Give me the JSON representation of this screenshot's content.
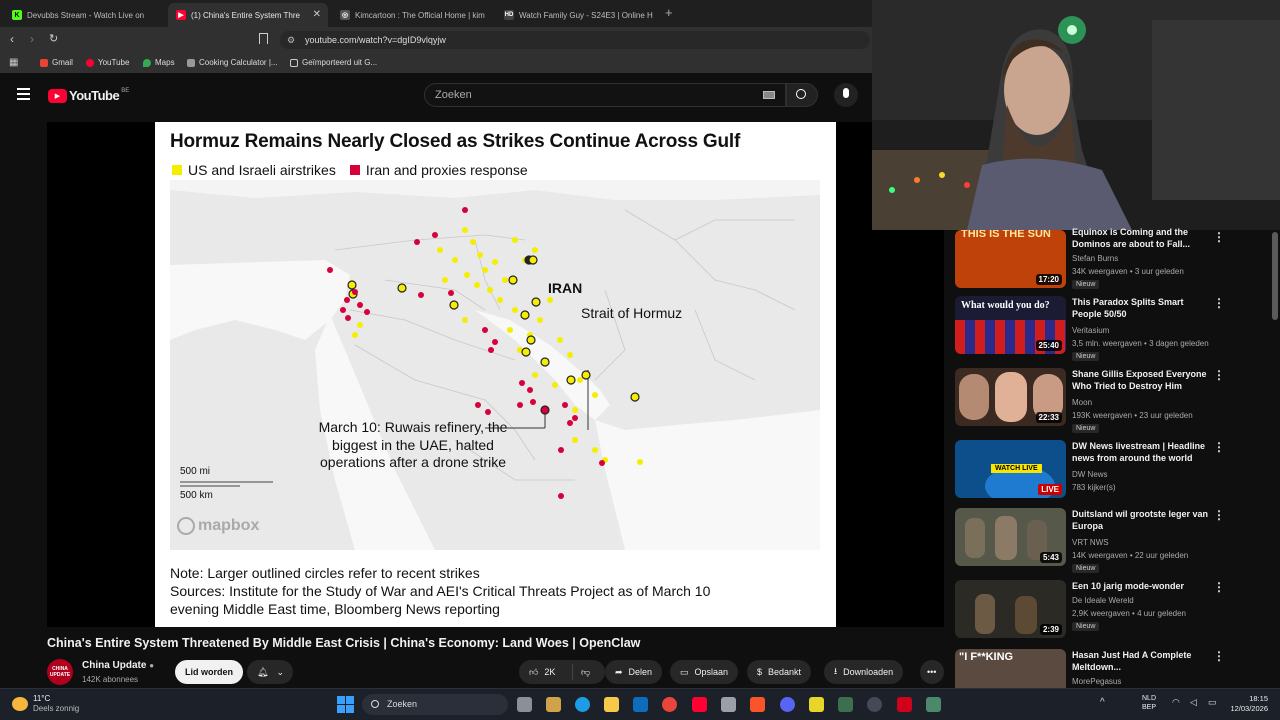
{
  "browser": {
    "tabs": [
      {
        "title": "Devubbs Stream - Watch Live on",
        "active": false
      },
      {
        "title": "(1) China's Entire System Thre",
        "active": true
      },
      {
        "title": "Kimcartoon : The Official Home | kim",
        "active": false
      },
      {
        "title": "Watch Family Guy - S24E3 | Online H",
        "active": false
      }
    ],
    "url": "youtube.com/watch?v=dgID9vlqyjw",
    "bookmarks": [
      "Gmail",
      "YouTube",
      "Maps",
      "Cooking Calculator |...",
      "Geïmporteerd uit G..."
    ]
  },
  "youtube": {
    "logo": "YouTube",
    "logo_region": "BE",
    "search_placeholder": "Zoeken"
  },
  "video_frame": {
    "title": "Hormuz Remains Nearly Closed as Strikes Continue Across Gulf",
    "legend": [
      {
        "label": "US and Israeli airstrikes",
        "color": "#f5ee00"
      },
      {
        "label": "Iran and proxies response",
        "color": "#d6003c"
      }
    ],
    "map_labels": {
      "country": "IRAN",
      "strait": "Strait of Hormuz",
      "annotation_line1": "March 10: Ruwais refinery, the",
      "annotation_line2": "biggest in the UAE, halted",
      "annotation_line3": "operations after a drone strike",
      "scale_mi": "500 mi",
      "scale_km": "500 km",
      "attribution": "mapbox"
    },
    "note": "Note: Larger outlined circles refer to recent strikes",
    "sources_line1": "Sources: Institute for the Study of War and AEI's Critical Threats Project as of March 10",
    "sources_line2": "evening Middle East time, Bloomberg News reporting"
  },
  "video": {
    "title": "China's Entire System Threatened By Middle East Crisis | China's Economy: Land Woes | OpenClaw",
    "channel": "China Update",
    "channel_avatar_text": "CHINA UPDATE",
    "subscribers": "142K abonnees",
    "subscribe_label": "Lid worden",
    "likes": "2K",
    "share_label": "Delen",
    "save_label": "Opslaan",
    "thanks_label": "Bedankt",
    "download_label": "Downloaden"
  },
  "recommendations": [
    {
      "title": "Equinox is Coming and the Dominos are about to Fall...",
      "channel": "Stefan Burns",
      "meta": "34K weergaven • 3 uur geleden",
      "badge": "Nieuw",
      "duration": "17:20",
      "thumb_text": "THIS IS THE SUN",
      "thumb_color": "#c0420b"
    },
    {
      "title": "This Paradox Splits Smart People 50/50",
      "channel": "Veritasium",
      "meta": "3,5 mln. weergaven • 3 dagen geleden",
      "badge": "Nieuw",
      "duration": "25:40",
      "thumb_text": "What would you do?",
      "thumb_color": "#1b1b33"
    },
    {
      "title": "Shane Gillis Exposed Everyone Who Tried to Destroy Him",
      "channel": "Moon",
      "meta": "193K weergaven • 23 uur geleden",
      "badge": "Nieuw",
      "duration": "22:33",
      "thumb_text": "",
      "thumb_color": "#3a2a22"
    },
    {
      "title": "DW News livestream | Headline news from around the world",
      "channel": "DW News",
      "meta": "783 kijker(s)",
      "badge": "",
      "duration": "LIVE",
      "thumb_text": "WATCH LIVE",
      "thumb_color": "#0d4f8a"
    },
    {
      "title": "Duitsland wil grootste leger van Europa",
      "channel": "VRT NWS",
      "meta": "14K weergaven • 22 uur geleden",
      "badge": "Nieuw",
      "duration": "5:43",
      "thumb_text": "",
      "thumb_color": "#56584a"
    },
    {
      "title": "Een 10 jarig mode-wonder",
      "channel": "De Ideale Wereld",
      "meta": "2,9K weergaven • 4 uur geleden",
      "badge": "Nieuw",
      "duration": "2:39",
      "thumb_text": "",
      "thumb_color": "#2c2a24"
    },
    {
      "title": "Hasan Just Had A Complete Meltdown...",
      "channel": "MorePegasus",
      "meta": "",
      "badge": "",
      "duration": "",
      "thumb_text": "\"I F**KING",
      "thumb_color": "#5a4a40"
    }
  ],
  "taskbar": {
    "weather_temp": "11°C",
    "weather_desc": "Deels zonnig",
    "search_placeholder": "Zoeken",
    "lang_line1": "NLD",
    "lang_line2": "BEP",
    "time": "18:15",
    "date": "12/03/2026"
  }
}
